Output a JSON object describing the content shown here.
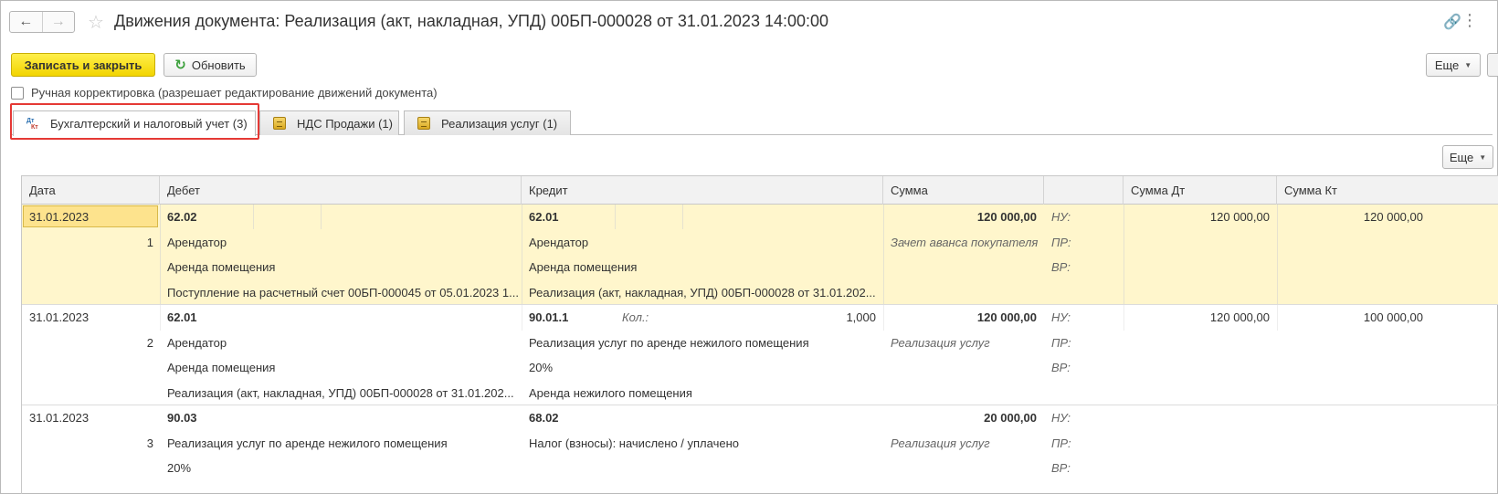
{
  "header": {
    "back_icon": "←",
    "forward_icon": "→",
    "star_icon": "☆",
    "title": "Движения документа: Реализация (акт, накладная, УПД) 00БП-000028 от 31.01.2023 14:00:00",
    "link_icon": "🔗",
    "menu_icon": "⋮"
  },
  "toolbar": {
    "save_close_label": "Записать и закрыть",
    "refresh_icon": "↻",
    "refresh_label": "Обновить",
    "more_label": "Еще",
    "caret": "▼"
  },
  "manual_edit": {
    "label": "Ручная корректировка (разрешает редактирование движений документа)",
    "checked": false
  },
  "tabs": [
    {
      "label": "Бухгалтерский и налоговый учет (3)",
      "active": true,
      "icon": "dt-kt-icon"
    },
    {
      "label": "НДС Продажи (1)",
      "active": false,
      "icon": "register-icon"
    },
    {
      "label": "Реализация услуг (1)",
      "active": false,
      "icon": "register-icon"
    }
  ],
  "icon_text": {
    "dt": "Дт",
    "kt": "Кт"
  },
  "table": {
    "more_label": "Еще",
    "columns": [
      "Дата",
      "Дебет",
      "Кредит",
      "Сумма",
      "",
      "Сумма Дт",
      "Сумма Кт"
    ],
    "rows": [
      {
        "date": "31.01.2023",
        "num": "1",
        "debit": [
          "62.02",
          "Арендатор",
          "Аренда помещения",
          "Поступление на расчетный счет 00БП-000045 от 05.01.2023 1..."
        ],
        "credit": [
          "62.01",
          "Арендатор",
          "Аренда помещения",
          "Реализация (акт, накладная, УПД) 00БП-000028 от 31.01.202..."
        ],
        "qty_label": "",
        "qty_value": "",
        "amount": "120 000,00",
        "content": "Зачет аванса покупателя",
        "nu": "НУ:",
        "pr": "ПР:",
        "vr": "ВР:",
        "sum_dt": "120 000,00",
        "sum_kt": "120 000,00"
      },
      {
        "date": "31.01.2023",
        "num": "2",
        "debit": [
          "62.01",
          "Арендатор",
          "Аренда помещения",
          "Реализация (акт, накладная, УПД) 00БП-000028 от 31.01.202..."
        ],
        "credit": [
          "90.01.1",
          "Реализация услуг по аренде нежилого помещения",
          "20%",
          "Аренда нежилого помещения"
        ],
        "qty_label": "Кол.:",
        "qty_value": "1,000",
        "amount": "120 000,00",
        "content": "Реализация услуг",
        "nu": "НУ:",
        "pr": "ПР:",
        "vr": "ВР:",
        "sum_dt": "120 000,00",
        "sum_kt": "100 000,00"
      },
      {
        "date": "31.01.2023",
        "num": "3",
        "debit": [
          "90.03",
          "Реализация услуг по аренде нежилого помещения",
          "20%",
          ""
        ],
        "credit": [
          "68.02",
          "Налог (взносы): начислено / уплачено",
          "",
          ""
        ],
        "qty_label": "",
        "qty_value": "",
        "amount": "20 000,00",
        "content": "Реализация услуг",
        "nu": "НУ:",
        "pr": "ПР:",
        "vr": "ВР:",
        "sum_dt": "",
        "sum_kt": ""
      }
    ]
  }
}
